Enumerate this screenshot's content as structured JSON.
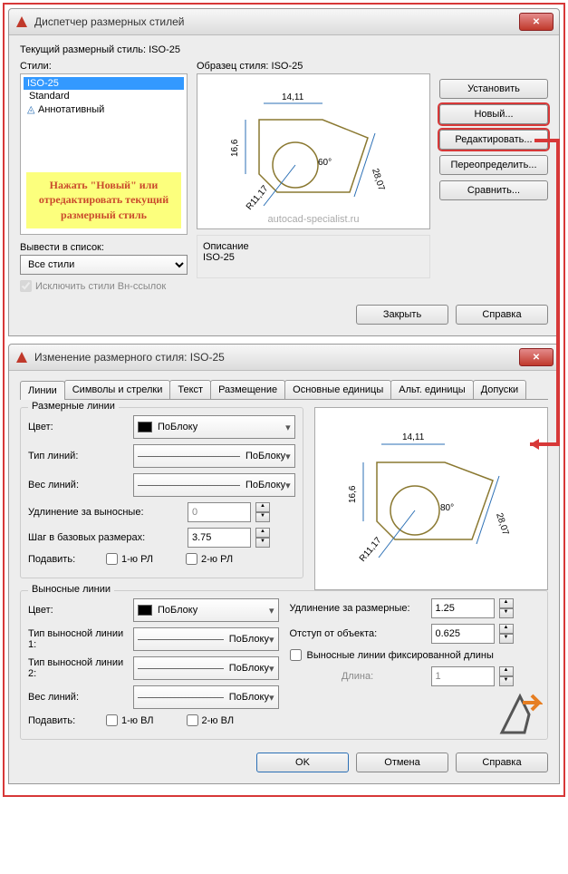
{
  "dialog1": {
    "title": "Диспетчер размерных стилей",
    "current_style_label": "Текущий размерный стиль: ISO-25",
    "styles_label": "Стили:",
    "sample_label": "Образец стиля: ISO-25",
    "list": {
      "item1": "ISO-25",
      "item2": "Standard",
      "item3": "Аннотативный"
    },
    "hint": "Нажать \"Новый\" или отредактировать текущий размерный стиль",
    "watermark": "autocad-specialist.ru",
    "buttons": {
      "set_current": "Установить",
      "new": "Новый...",
      "modify": "Редактировать...",
      "override": "Переопределить...",
      "compare": "Сравнить..."
    },
    "list_select_label": "Вывести в список:",
    "list_select_value": "Все стили",
    "exclude_xref": "Исключить стили Вн-ссылок",
    "desc_label": "Описание",
    "desc_value": "ISO-25",
    "close": "Закрыть",
    "help": "Справка"
  },
  "dialog2": {
    "title": "Изменение размерного стиля: ISO-25",
    "tabs": {
      "t1": "Линии",
      "t2": "Символы и стрелки",
      "t3": "Текст",
      "t4": "Размещение",
      "t5": "Основные единицы",
      "t6": "Альт. единицы",
      "t7": "Допуски"
    },
    "group1": {
      "title": "Размерные линии",
      "color": "Цвет:",
      "color_val": "ПоБлоку",
      "ltype": "Тип линий:",
      "ltype_val": "ПоБлоку",
      "lweight": "Вес линий:",
      "lweight_val": "ПоБлоку",
      "extend": "Удлинение за выносные:",
      "extend_val": "0",
      "baseline": "Шаг в базовых размерах:",
      "baseline_val": "3.75",
      "suppress": "Подавить:",
      "sup1": "1-ю РЛ",
      "sup2": "2-ю РЛ"
    },
    "group2": {
      "title": "Выносные линии",
      "color": "Цвет:",
      "color_val": "ПоБлоку",
      "ltype1": "Тип выносной линии 1:",
      "ltype1_val": "ПоБлоку",
      "ltype2": "Тип выносной линии 2:",
      "ltype2_val": "ПоБлоку",
      "lweight": "Вес линий:",
      "lweight_val": "ПоБлоку",
      "suppress": "Подавить:",
      "sup1": "1-ю ВЛ",
      "sup2": "2-ю ВЛ",
      "extend": "Удлинение за размерные:",
      "extend_val": "1.25",
      "offset": "Отступ от объекта:",
      "offset_val": "0.625",
      "fixed": "Выносные линии фиксированной длины",
      "length": "Длина:",
      "length_val": "1"
    },
    "ok": "OK",
    "cancel": "Отмена",
    "help": "Справка"
  },
  "preview_dims": {
    "d1": "14,11",
    "d2": "16,6",
    "d3": "28,07",
    "d4": "R11,17",
    "d5": "60°",
    "d5b": "80°"
  }
}
